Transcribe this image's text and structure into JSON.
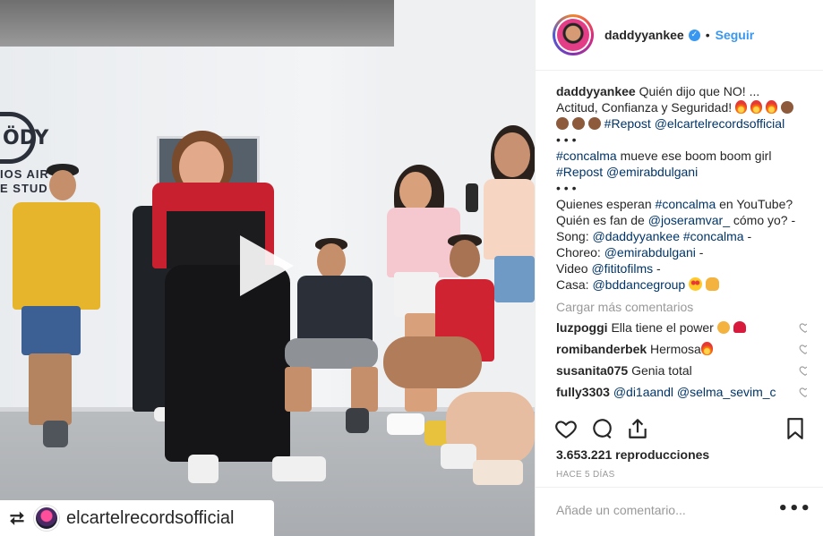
{
  "media": {
    "studio_logo_text": "ÖDY",
    "studio_name_line1": "IOS AIR",
    "studio_name_line2": "E STUD",
    "repost_username": "elcartelrecordsofficial"
  },
  "header": {
    "username": "daddyyankee",
    "dot": "•",
    "follow_label": "Seguir"
  },
  "caption": {
    "username": "daddyyankee",
    "line1": " Quién dijo que NO! ...",
    "line2": "Actitud, Confianza y Seguridad! ",
    "repost1": "#Repost",
    "repost1_user": "@elcartelrecordsofficial",
    "dots": "• • •",
    "tag_concalma": "#concalma",
    "line_boom": " mueve ese boom boom girl",
    "repost2": "#Repost",
    "repost2_user": "@emirabdulgani",
    "q1_a": "Quienes esperan ",
    "q1_tag": "#concalma",
    "q1_b": " en YouTube?",
    "q2_a": "Quién es fan de ",
    "q2_user": "@joseramvar_",
    "q2_b": " cómo yo? -",
    "song_a": "Song: ",
    "song_user": "@daddyyankee",
    "song_tag": "#concalma",
    "song_b": " -",
    "choreo_a": "Choreo: ",
    "choreo_user": "@emirabdulgani",
    "choreo_b": " -",
    "video_a": "Video ",
    "video_user": "@fititofilms",
    "video_b": " -",
    "casa_a": "Casa: ",
    "casa_user": "@bddancegroup"
  },
  "load_more": "Cargar más comentarios",
  "comments": [
    {
      "user": "luzpoggi",
      "text": "Ella tiene el power"
    },
    {
      "user": "romibanderbek",
      "text": "Hermosa"
    },
    {
      "user": "susanita075",
      "text": "Genia total"
    },
    {
      "user": "fully3303",
      "text": "@di1aandl @selma_sevim_c"
    }
  ],
  "stats": {
    "views": "3.653.221 reproducciones",
    "date": "HACE 5 DÍAS"
  },
  "add_comment": {
    "placeholder": "Añade un comentario...",
    "more": "•••"
  },
  "icons": {
    "like": "heart-icon",
    "comment": "comment-icon",
    "share": "share-icon",
    "save": "bookmark-icon",
    "play": "play-icon",
    "repost": "repost-icon",
    "verified": "verified-badge-icon"
  },
  "colors": {
    "link_blue": "#3897f0",
    "hashtag": "#003569",
    "muted": "#999999"
  }
}
